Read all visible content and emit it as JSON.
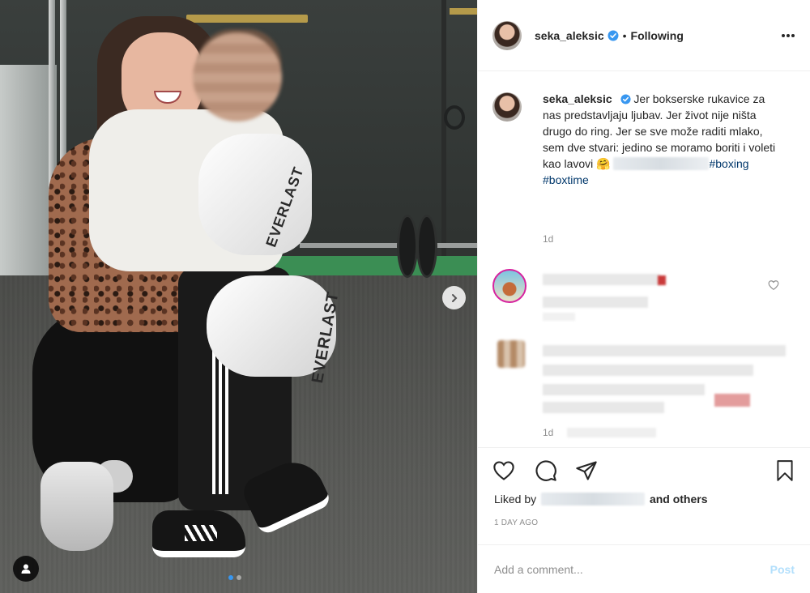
{
  "post": {
    "username": "seka_aleksic",
    "separator": "•",
    "follow_status": "Following",
    "verified": true,
    "more_icon": "more-horizontal-icon"
  },
  "caption": {
    "username": "seka_aleksic",
    "text": "Jer bokserske rukavice za nas predstavljaju ljubav. Jer život nije ništa drugo do ring. Jer se sve može raditi mlako, sem dve stvari: jedino se moramo boriti i voleti kao lavovi",
    "emoji": "🤗",
    "hashtag1": "#boxing",
    "hashtag2": "#boxtime",
    "time": "1d"
  },
  "comments": [
    {
      "time": ""
    },
    {
      "time": "1d"
    }
  ],
  "photo": {
    "glove_text_1": "EVERLAST",
    "glove_text_2": "EVERLAST",
    "carousel_index": 0,
    "carousel_count": 2
  },
  "actions": {
    "icons": [
      "heart-icon",
      "comment-icon",
      "share-icon",
      "bookmark-icon"
    ],
    "liked_by_prefix": "Liked by",
    "liked_by_suffix": "and others",
    "date": "1 DAY AGO"
  },
  "composer": {
    "placeholder": "Add a comment...",
    "post_label": "Post"
  },
  "colors": {
    "accent": "#3897f0",
    "hashtag": "#00376b",
    "post_disabled": "#b2dffc",
    "muted": "#8e8e8e"
  }
}
